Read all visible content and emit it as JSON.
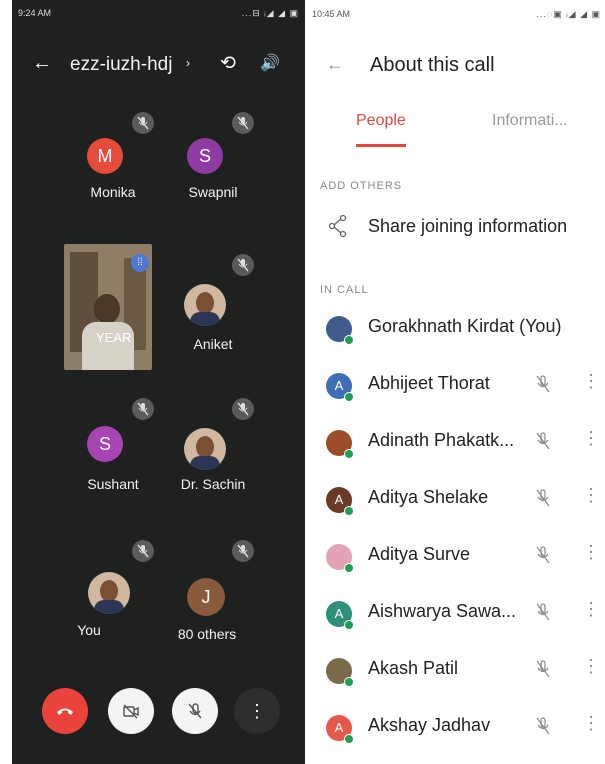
{
  "left": {
    "status_time": "9:24 AM",
    "status_icons": "...⊟ ᵢ◢ ◢ ▣",
    "meeting_code": "ezz-iuzh-hdj",
    "video_tile_name": "YEAR",
    "tiles": [
      {
        "name": "Monika",
        "initial": "M",
        "color": "#e64a3b"
      },
      {
        "name": "Swapnil",
        "initial": "S",
        "color": "#8e3ca3"
      },
      {
        "name": "Aniket",
        "initial": "",
        "color": "#c9a98f"
      },
      {
        "name": "Sushant",
        "initial": "S",
        "color": "#a944b5"
      },
      {
        "name": "Dr. Sachin",
        "initial": "",
        "color": "#c9a98f"
      },
      {
        "name": "You",
        "initial": "",
        "color": "#6e8dc4"
      },
      {
        "name": "80 others",
        "initial": "J",
        "color": "#8a5a3c"
      }
    ]
  },
  "right": {
    "status_time": "10:45 AM",
    "status_icons": "...◌▣ ᵢ◢ ◢ ▣",
    "title": "About this call",
    "tabs": [
      "People",
      "Informati..."
    ],
    "add_others_label": "ADD OTHERS",
    "share_label": "Share joining information",
    "in_call_label": "IN CALL",
    "participants": [
      {
        "name": "Gorakhnath Kirdat (You)",
        "initial": "",
        "color": "#3f5b8a"
      },
      {
        "name": "Abhijeet Thorat",
        "initial": "A",
        "color": "#3d6fb6"
      },
      {
        "name": "Adinath Phakatk...",
        "initial": "",
        "color": "#9c4e2a"
      },
      {
        "name": "Aditya Shelake",
        "initial": "A",
        "color": "#6b3a26"
      },
      {
        "name": "Aditya Surve",
        "initial": "",
        "color": "#e2a4b4"
      },
      {
        "name": "Aishwarya Sawa...",
        "initial": "A",
        "color": "#2f8f78"
      },
      {
        "name": "Akash Patil",
        "initial": "",
        "color": "#7a6a4a"
      },
      {
        "name": "Akshay Jadhav",
        "initial": "A",
        "color": "#e9574a"
      }
    ]
  }
}
